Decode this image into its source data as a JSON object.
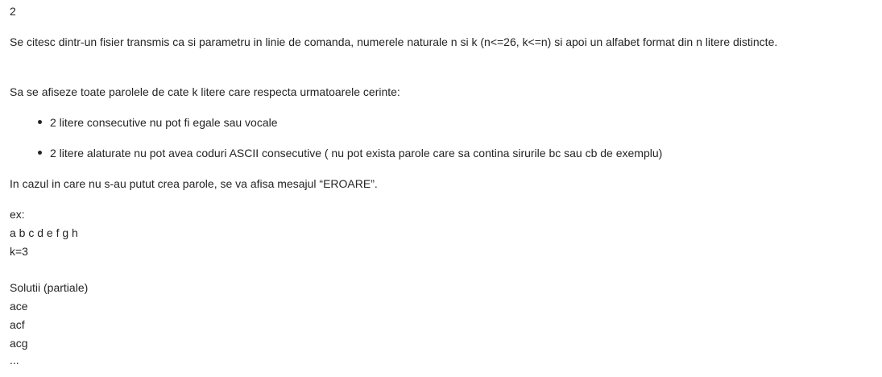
{
  "document": {
    "number": "2",
    "intro": "Se citesc dintr-un fisier transmis ca si parametru in linie de comanda, numerele naturale n si k (n<=26, k<=n) si apoi un alfabet format din n litere distincte.",
    "task": "Sa se afiseze toate parolele de cate k litere care respecta urmatoarele cerinte:",
    "requirements": [
      "2 litere consecutive nu pot fi egale sau vocale",
      "2 litere alaturate nu pot avea coduri ASCII consecutive ( nu pot exista parole care sa contina sirurile bc sau cb de exemplu)"
    ],
    "error_note": "In cazul in care nu s-au putut crea parole, se va afisa mesajul “EROARE”.",
    "example": {
      "label": "ex:",
      "alphabet": "a b c d e f g h",
      "k": "k=3"
    },
    "solutions": {
      "label": "Solutii (partiale)",
      "items": [
        "ace",
        "acf",
        "acg",
        "..."
      ]
    }
  }
}
